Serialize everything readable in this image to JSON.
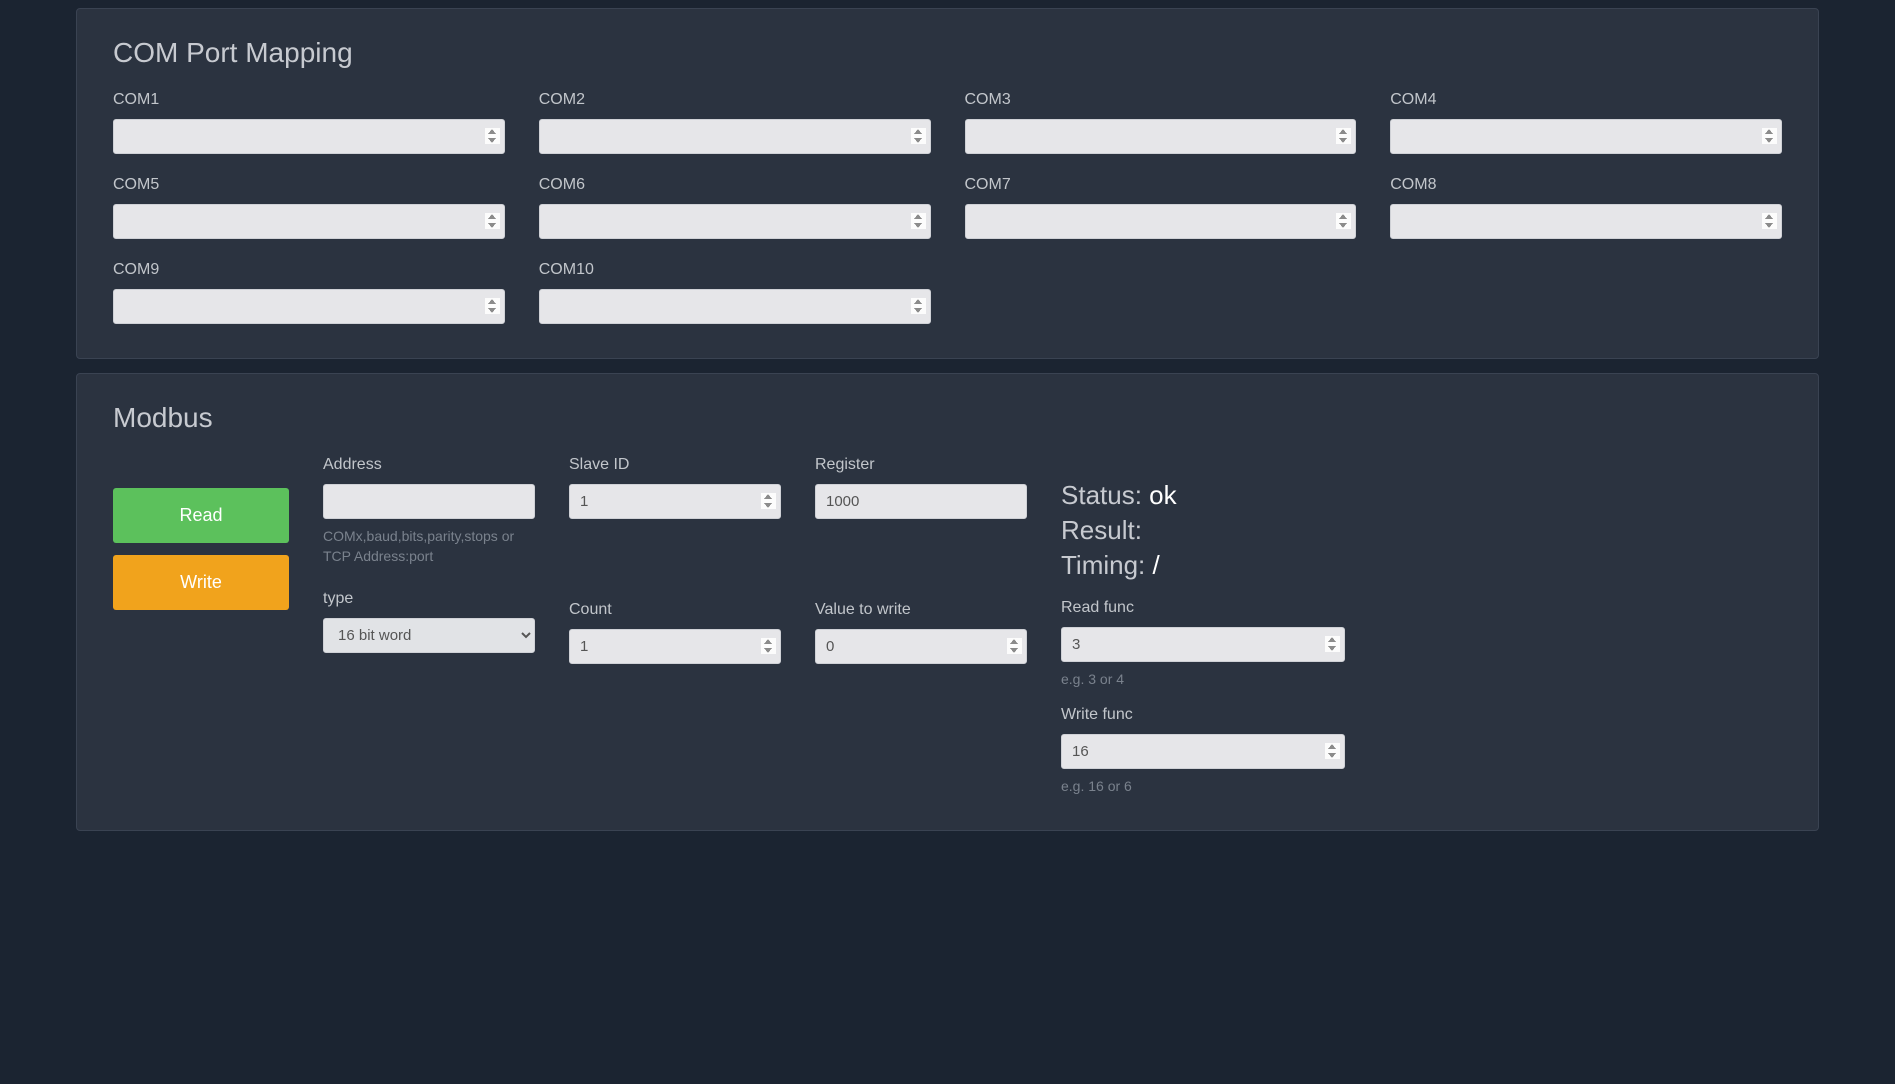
{
  "com_mapping": {
    "title": "COM Port Mapping",
    "ports": [
      {
        "label": "COM1",
        "value": ""
      },
      {
        "label": "COM2",
        "value": ""
      },
      {
        "label": "COM3",
        "value": ""
      },
      {
        "label": "COM4",
        "value": ""
      },
      {
        "label": "COM5",
        "value": ""
      },
      {
        "label": "COM6",
        "value": ""
      },
      {
        "label": "COM7",
        "value": ""
      },
      {
        "label": "COM8",
        "value": ""
      },
      {
        "label": "COM9",
        "value": ""
      },
      {
        "label": "COM10",
        "value": ""
      }
    ]
  },
  "modbus": {
    "title": "Modbus",
    "buttons": {
      "read": "Read",
      "write": "Write"
    },
    "address": {
      "label": "Address",
      "value": "",
      "helper": "COMx,baud,bits,parity,stops or TCP Address:port"
    },
    "slave_id": {
      "label": "Slave ID",
      "value": "1"
    },
    "register": {
      "label": "Register",
      "value": "1000"
    },
    "type": {
      "label": "type",
      "value": "16 bit word"
    },
    "count": {
      "label": "Count",
      "value": "1"
    },
    "value_to_write": {
      "label": "Value to write",
      "value": "0"
    },
    "status": {
      "label": "Status: ",
      "value": "ok"
    },
    "result": {
      "label": "Result:",
      "value": ""
    },
    "timing": {
      "label": "Timing: ",
      "value": "/"
    },
    "read_func": {
      "label": "Read func",
      "value": "3",
      "helper": "e.g. 3 or 4"
    },
    "write_func": {
      "label": "Write func",
      "value": "16",
      "helper": "e.g. 16 or 6"
    }
  }
}
